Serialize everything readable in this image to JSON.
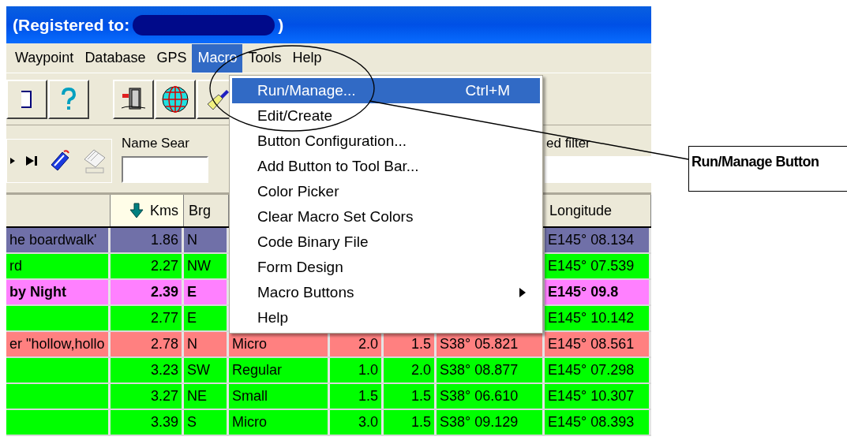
{
  "window": {
    "title_start": "(Registered to:",
    "title_end": ")"
  },
  "menu_bar": [
    {
      "label": "Waypoint",
      "selected": false
    },
    {
      "label": "Database",
      "selected": false
    },
    {
      "label": "GPS",
      "selected": false
    },
    {
      "label": "Macro",
      "selected": true
    },
    {
      "label": "Tools",
      "selected": false
    },
    {
      "label": "Help",
      "selected": false
    }
  ],
  "search": {
    "label": "Name Sear",
    "filter_label": "ed filter"
  },
  "dropdown": [
    {
      "label": "Run/Manage...",
      "shortcut": "Ctrl+M",
      "selected": true,
      "submenu": false
    },
    {
      "label": "Edit/Create",
      "selected": false,
      "submenu": false
    },
    {
      "label": "Button Configuration...",
      "selected": false,
      "submenu": false
    },
    {
      "label": "Add Button to Tool Bar...",
      "selected": false,
      "submenu": false
    },
    {
      "label": "Color Picker",
      "selected": false,
      "submenu": false
    },
    {
      "label": "Clear Macro Set Colors",
      "selected": false,
      "submenu": false
    },
    {
      "label": "Code Binary File",
      "selected": false,
      "submenu": false
    },
    {
      "label": "Form Design",
      "selected": false,
      "submenu": false
    },
    {
      "label": "Macro Buttons",
      "selected": false,
      "submenu": true
    },
    {
      "label": "Help",
      "selected": false,
      "submenu": false
    }
  ],
  "table": {
    "columns": [
      {
        "kind": "header",
        "sorted": false
      },
      {
        "kind": "header",
        "label": "Kms",
        "sorted": true
      },
      {
        "kind": "header",
        "label": "Brg",
        "sorted": false
      },
      {
        "kind": "covered"
      },
      {
        "kind": "covered"
      },
      {
        "kind": "covered"
      },
      {
        "kind": "covered"
      },
      {
        "kind": "header",
        "label": "Longitude",
        "sorted": false
      }
    ],
    "rows": [
      {
        "color": "#7070a8",
        "bold": false,
        "cells": [
          "he boardwalk'",
          "1.86",
          "N",
          null,
          null,
          null,
          null,
          "E145° 08.134"
        ]
      },
      {
        "color": "#00ff00",
        "bold": false,
        "cells": [
          "rd",
          "2.27",
          "NW",
          null,
          null,
          null,
          null,
          "E145° 07.539"
        ]
      },
      {
        "color": "#ff80ff",
        "bold": true,
        "cells": [
          "by Night",
          "2.39",
          "E",
          null,
          null,
          null,
          null,
          "E145° 09.8"
        ]
      },
      {
        "color": "#00ff00",
        "bold": false,
        "cells": [
          null,
          "2.77",
          "E",
          null,
          null,
          null,
          null,
          "E145° 10.142"
        ]
      },
      {
        "color": "#ff8080",
        "bold": false,
        "cells": [
          "er \"hollow,hollo",
          "2.78",
          "N",
          "Micro",
          "2.0",
          "1.5",
          "S38° 05.821",
          "E145° 08.561"
        ]
      },
      {
        "color": "#00ff00",
        "bold": false,
        "cells": [
          null,
          "3.23",
          "SW",
          "Regular",
          "1.0",
          "2.0",
          "S38° 08.877",
          "E145° 07.298"
        ]
      },
      {
        "color": "#00ff00",
        "bold": false,
        "cells": [
          null,
          "3.27",
          "NE",
          "Small",
          "1.5",
          "1.5",
          "S38° 06.610",
          "E145° 10.307"
        ]
      },
      {
        "color": "#00ff00",
        "bold": false,
        "cells": [
          null,
          "3.39",
          "S",
          "Micro",
          "3.0",
          "1.5",
          "S38° 09.129",
          "E145° 08.393"
        ]
      }
    ]
  },
  "callout": {
    "label": "Run/Manage Button"
  }
}
